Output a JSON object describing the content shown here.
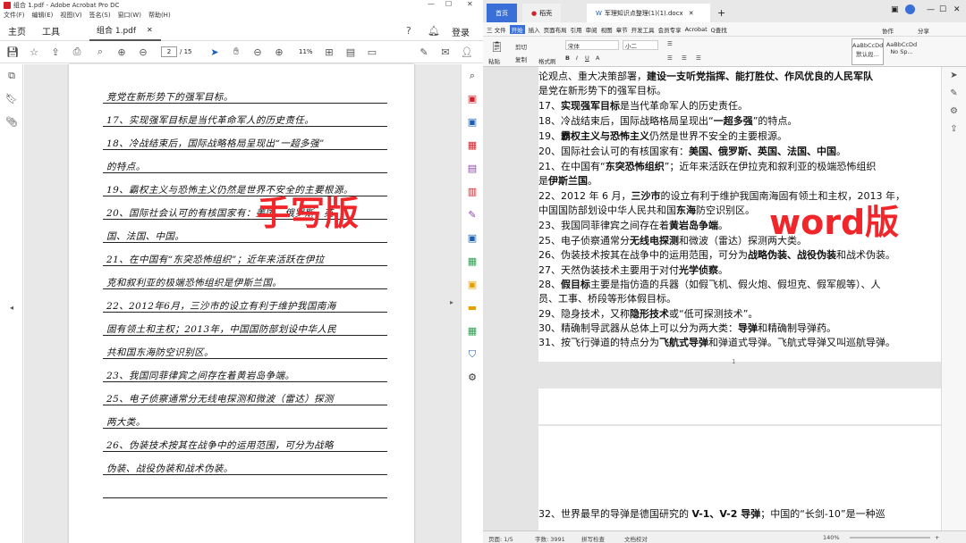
{
  "acrobat": {
    "window_title": "组合 1.pdf - Adobe Acrobat Pro DC",
    "menu": [
      "文件(F)",
      "编辑(E)",
      "视图(V)",
      "签名(S)",
      "窗口(W)",
      "帮助(H)"
    ],
    "tabs": {
      "home": "主页",
      "tools": "工具",
      "doc": "组合 1.pdf"
    },
    "login": "登录",
    "page_current": "2",
    "page_total": "/ 15",
    "zoom": "11%",
    "handwritten_lines": [
      "竞党在新形势下的强军目标。",
      "17、实现强军目标是当代革命军人的历史责任。",
      "18、冷战结束后，国际战略格局呈现出“一超多强”",
      "的特点。",
      "19、霸权主义与恐怖主义仍然是世界不安全的主要根源。",
      "20、国际社会认可的有核国家有：美国、俄罗斯、英",
      "国、法国、中国。",
      "21、在中国有“东突恐怖组织”；近年来活跃在伊拉",
      "克和叙利亚的极端恐怖组织是伊斯兰国。",
      "22、2012年6月，三沙市的设立有利于维护我国南海",
      "固有领土和主权；2013年，中国国防部划设中华人民",
      "共和国东海防空识别区。",
      "23、我国同菲律宾之间存在着黄岩岛争端。",
      "25、电子侦察通常分无线电探测和微波（雷达）探测",
      "两大类。",
      "26、伪装技术按其在战争中的运用范围，可分为战略",
      "伪装、战役伪装和战术伪装。"
    ],
    "overlay_label": "手写版"
  },
  "wps": {
    "tabs": {
      "home": "首页",
      "daoke": "稻壳",
      "doc": "军理知识点整理(1)(1).docx"
    },
    "ribbon_menu": [
      "三 文件",
      "开始",
      "插入",
      "页面布局",
      "引用",
      "审阅",
      "视图",
      "章节",
      "开发工具",
      "会员专享",
      "Acrobat",
      "Q查找"
    ],
    "collab": "协作",
    "share": "分享",
    "font_name": "宋体",
    "font_size": "小二",
    "styles": [
      "AaBbCcDd",
      "AaBbCcDd"
    ],
    "style_names": [
      "默认段...",
      "No Sp..."
    ],
    "clipboard": {
      "paste": "粘贴",
      "cut": "剪切",
      "copy": "复制",
      "format": "格式刷"
    },
    "lines": [
      {
        "pre": "论观点、重大决策部署，",
        "b": "建设一支听党指挥、能打胜仗、作风优良的人民军队",
        "post": ""
      },
      {
        "pre": "是党在新形势下的强军目标。",
        "b": "",
        "post": ""
      },
      {
        "pre": "17、",
        "b": "实现强军目标",
        "post": "是当代革命军人的历史责任。"
      },
      {
        "pre": "18、冷战结束后，国际战略格局呈现出“",
        "b": "一超多强",
        "post": "”的特点。"
      },
      {
        "pre": "19、",
        "b": "霸权主义与恐怖主义",
        "post": "仍然是世界不安全的主要根源。"
      },
      {
        "pre": "20、国际社会认可的有核国家有：",
        "b": "美国、俄罗斯、英国、法国、中国",
        "post": "。"
      },
      {
        "pre": "21、在中国有“",
        "b": "东突恐怖组织",
        "post": "”；近年来活跃在伊拉克和叙利亚的极端恐怖组织"
      },
      {
        "pre": "是",
        "b": "伊斯兰国",
        "post": "。"
      },
      {
        "pre": "22、2012 年 6 月，",
        "b": "三沙市",
        "post": "的设立有利于维护我国南海固有领土和主权，2013 年，"
      },
      {
        "pre": "中国国防部划设中华人民共和国",
        "b": "东海",
        "post": "防空识别区。"
      },
      {
        "pre": "23、我国同菲律宾之间存在着",
        "b": "黄岩岛争端",
        "post": "。"
      },
      {
        "pre": "25、电子侦察通常分",
        "b": "无线电探测",
        "post": "和微波（雷达）探测两大类。"
      },
      {
        "pre": "26、伪装技术按其在战争中的运用范围，可分为",
        "b": "战略伪装、战役伪装",
        "post": "和战术伪装。"
      },
      {
        "pre": "27、天然伪装技术主要用于对付",
        "b": "光学侦察",
        "post": "。"
      },
      {
        "pre": "28、",
        "b": "假目标",
        "post": "主要是指仿造的兵器（如假飞机、假火炮、假坦克、假军舰等）、人"
      },
      {
        "pre": "员、工事、桥段等形体假目标。",
        "b": "",
        "post": ""
      },
      {
        "pre": "29、隐身技术，又称",
        "b": "隐形技术",
        "post": "或“低可探测技术”。"
      },
      {
        "pre": "30、精确制导武器从总体上可以分为两大类：",
        "b": "导弹",
        "post": "和精确制导弹药。"
      },
      {
        "pre": "31、按飞行弹道的特点分为",
        "b": "飞航式导弹",
        "post": "和弹道式导弹。飞航式导弹又叫巡航导弹。"
      }
    ],
    "page_number": "1",
    "bottom_line": {
      "pre": "32、世界最早的导弹是德国研究的 ",
      "b": "V-1、V-2 导弹",
      "post": "；中国的“长剑-10”是一种巡"
    },
    "overlay_label": "word版",
    "status": {
      "page": "页面: 1/5",
      "words": "字数: 3991",
      "spell": "拼写检查",
      "proof": "文档校对",
      "zoom": "140%"
    }
  }
}
